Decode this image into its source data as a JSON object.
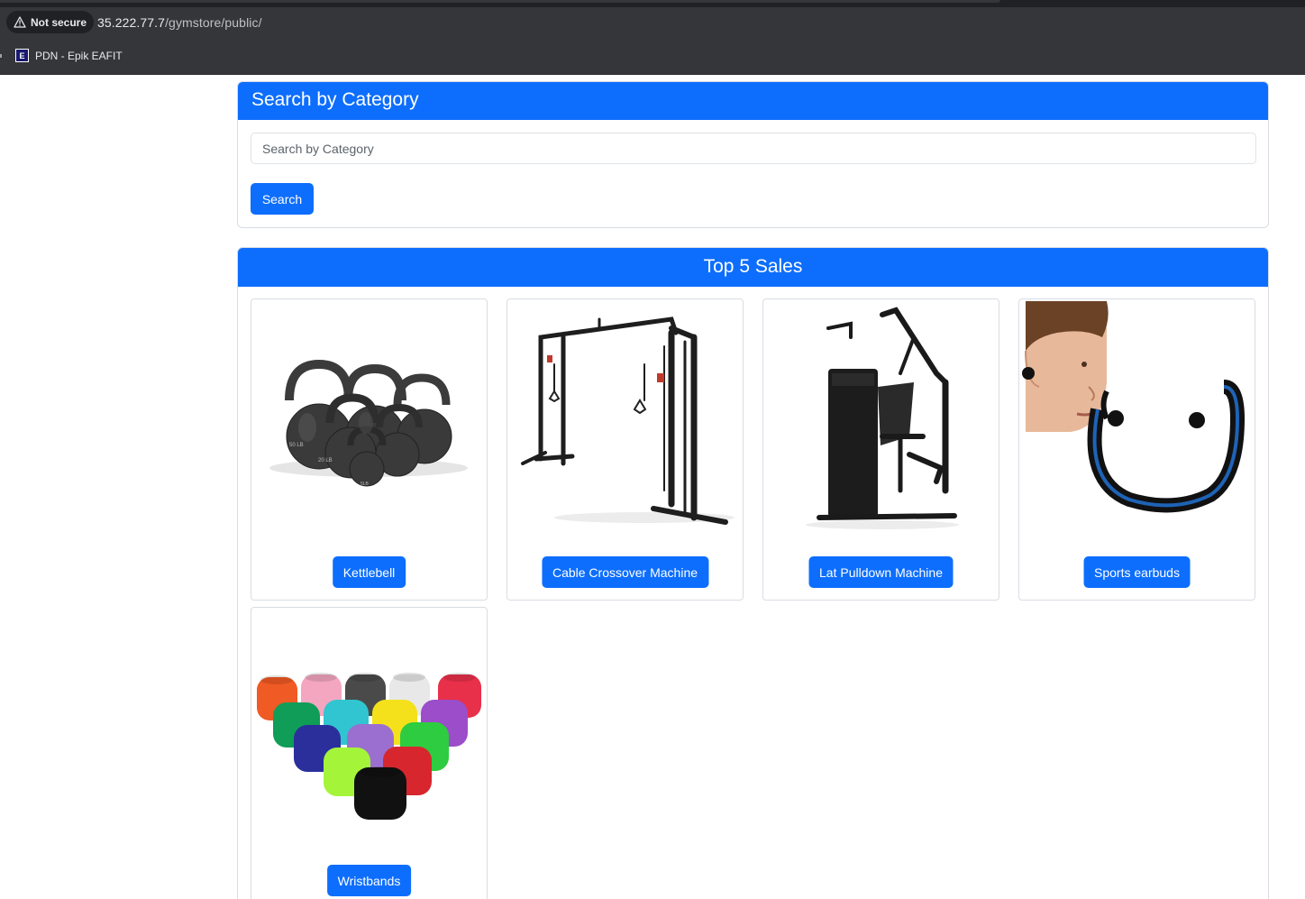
{
  "browser": {
    "security_label": "Not secure",
    "url_host": "35.222.77.7",
    "url_path": "/gymstore/public/",
    "bookmarks": [
      {
        "icon": "epik-eafit-favicon",
        "letter": "E",
        "label": "PDN - Epik EAFIT"
      }
    ]
  },
  "search": {
    "title": "Search by Category",
    "placeholder": "Search by Category",
    "button_label": "Search"
  },
  "top_sales": {
    "title": "Top 5 Sales",
    "products": [
      {
        "name": "Kettlebell",
        "image": "kettlebells-image"
      },
      {
        "name": "Cable Crossover Machine",
        "image": "cable-crossover-image"
      },
      {
        "name": "Lat Pulldown Machine",
        "image": "lat-pulldown-image"
      },
      {
        "name": "Sports earbuds",
        "image": "sports-earbuds-image"
      },
      {
        "name": "Wristbands",
        "image": "wristbands-image"
      }
    ]
  },
  "colors": {
    "primary": "#0d6efd",
    "chrome_dark": "#35363a"
  }
}
